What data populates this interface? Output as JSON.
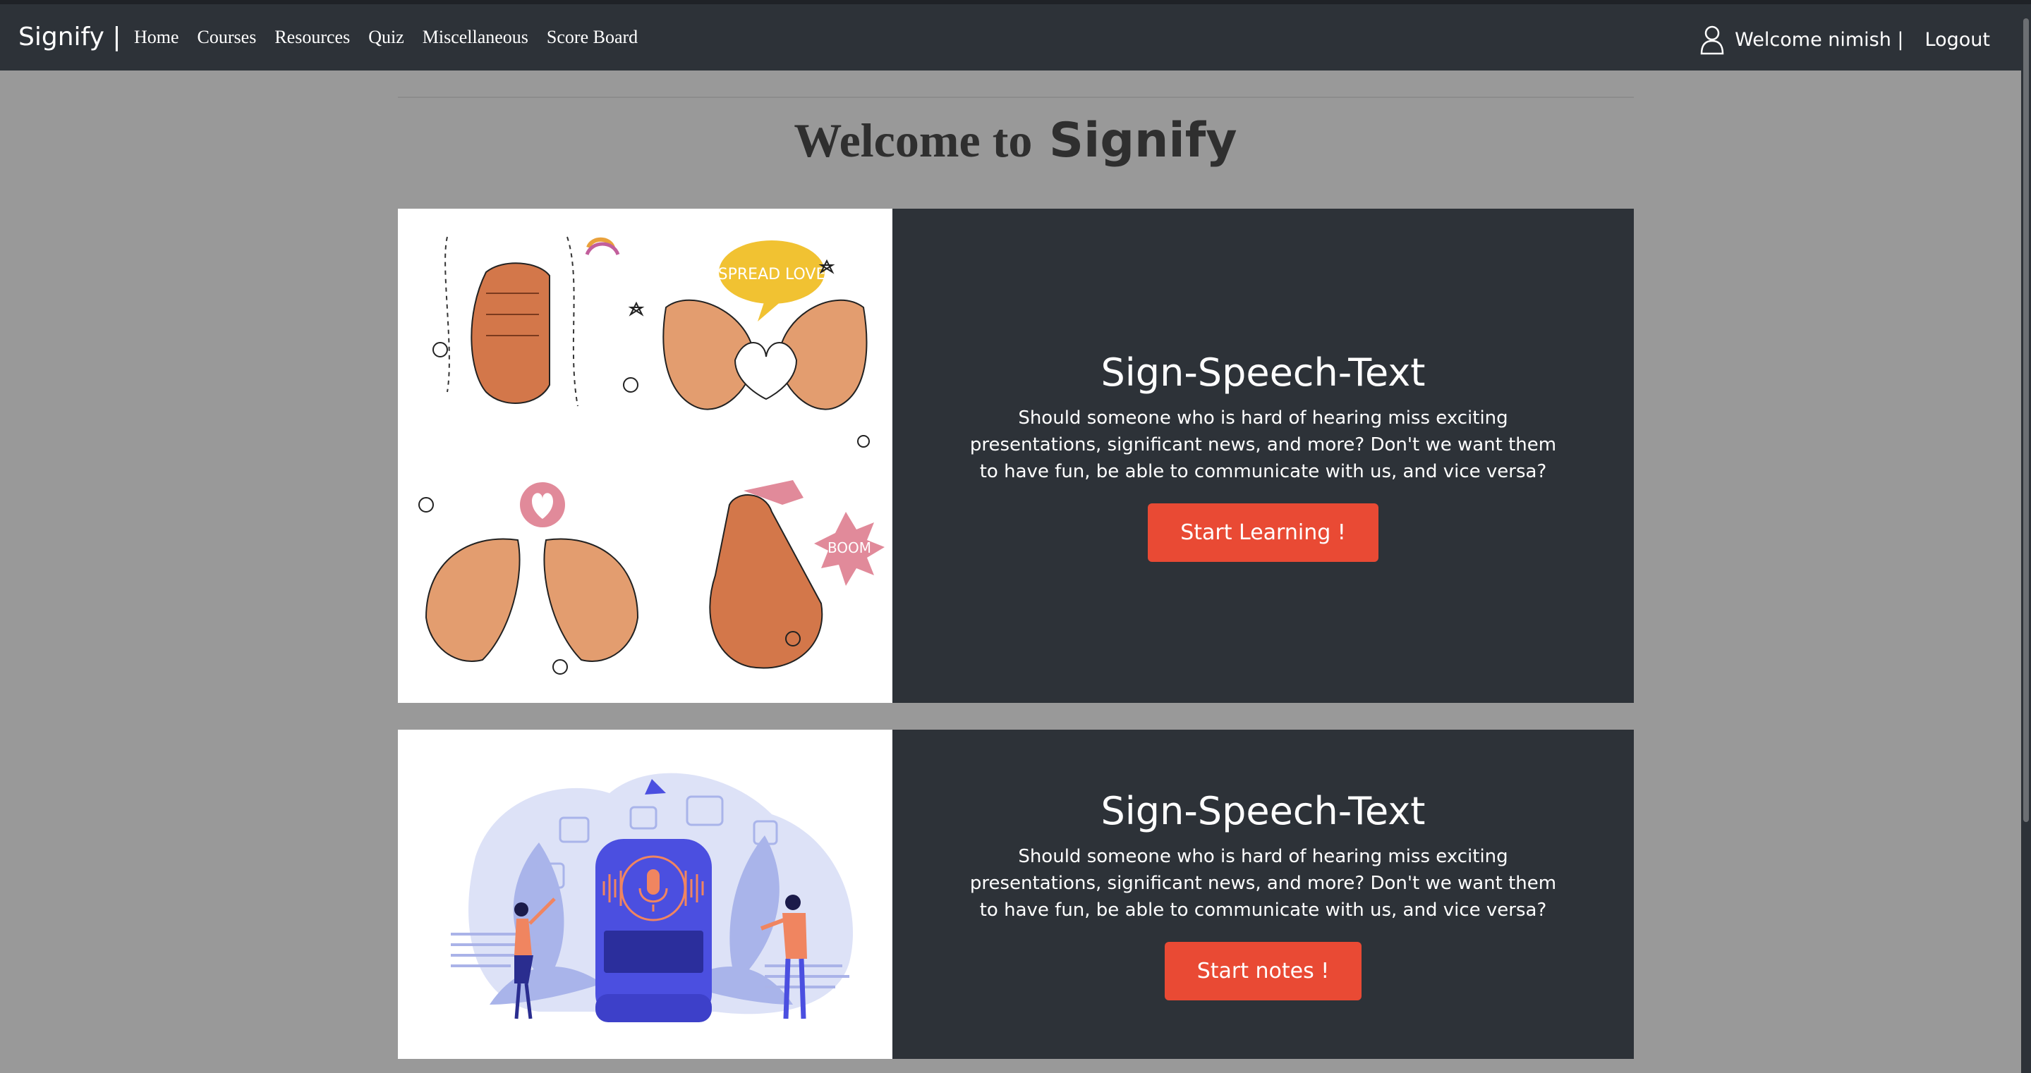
{
  "navbar": {
    "brand": "Signify |",
    "links": [
      "Home",
      "Courses",
      "Resources",
      "Quiz",
      "Miscellaneous",
      "Score Board"
    ],
    "welcome": "Welcome nimish |",
    "logout": "Logout"
  },
  "heading": {
    "prefix": "Welcome to",
    "brand": "Signify"
  },
  "cards": [
    {
      "title": "Sign-Speech-Text",
      "text": "Should someone who is hard of hearing miss exciting presentations, significant news, and more? Don't we want them to have fun, be able to communicate with us, and vice versa?",
      "button": "Start Learning !",
      "illustration_text": [
        "SPREAD LOVE",
        "BOOM"
      ]
    },
    {
      "title": "Sign-Speech-Text",
      "text": "Should someone who is hard of hearing miss exciting presentations, significant news, and more? Don't we want them to have fun, be able to communicate with us, and vice versa?",
      "button": "Start notes !"
    }
  ],
  "colors": {
    "navbar": "#2d3238",
    "page_bg": "#999999",
    "button": "#e94a34",
    "card_body": "#2d3238"
  }
}
